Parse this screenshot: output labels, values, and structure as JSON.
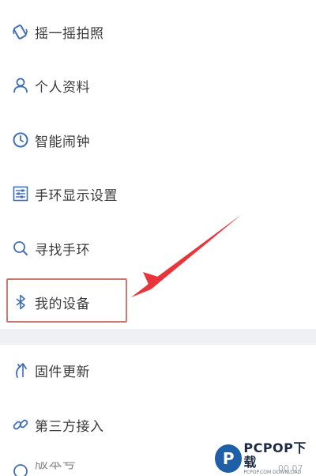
{
  "menu": {
    "items": [
      {
        "label": "摇一摇拍照",
        "icon": "shake-icon"
      },
      {
        "label": "个人资料",
        "icon": "user-icon"
      },
      {
        "label": "智能闹钟",
        "icon": "alarm-clock-icon"
      },
      {
        "label": "手环显示设置",
        "icon": "sliders-icon"
      },
      {
        "label": "寻找手环",
        "icon": "search-icon"
      },
      {
        "label": "我的设备",
        "icon": "bluetooth-icon"
      },
      {
        "label": "固件更新",
        "icon": "update-arrow-icon"
      },
      {
        "label": "第三方接入",
        "icon": "link-icon"
      }
    ],
    "partial_label": "版本号",
    "partial_value": "00.07"
  },
  "watermark": {
    "logo_letter": "P",
    "text": "PCPOP下载",
    "sub": "PCPOP.COM DOWNLOAD"
  },
  "colors": {
    "icon_blue": "#3f6eb3",
    "text": "#3a3a3a",
    "highlight_box": "#c97a73",
    "arrow": "#e8343a",
    "separator": "#eef0f4"
  }
}
